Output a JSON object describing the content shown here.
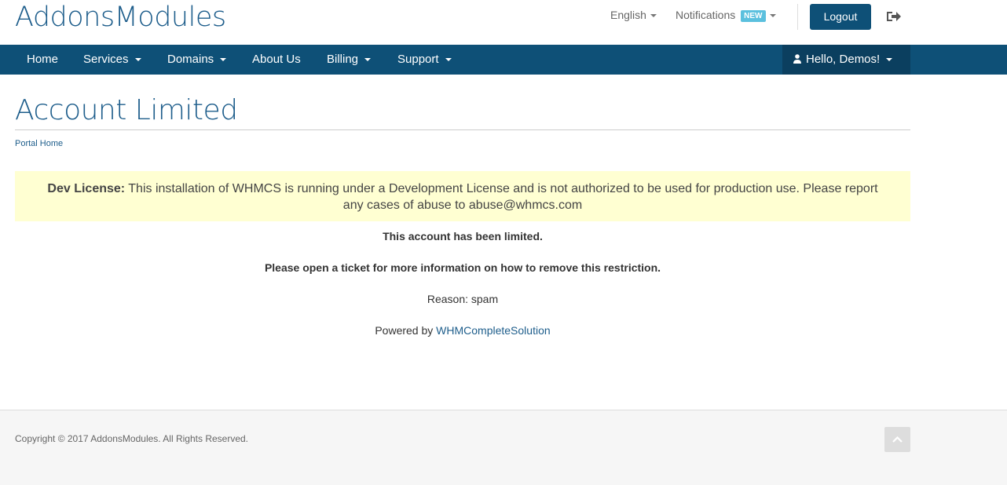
{
  "header": {
    "logo": "AddonsModules",
    "language": "English",
    "notifications_label": "Notifications",
    "notifications_badge": "NEW",
    "logout_label": "Logout"
  },
  "nav": {
    "items": [
      {
        "label": "Home"
      },
      {
        "label": "Services"
      },
      {
        "label": "Domains"
      },
      {
        "label": "About Us"
      },
      {
        "label": "Billing"
      },
      {
        "label": "Support"
      }
    ],
    "user_greeting": "Hello, Demos!"
  },
  "page": {
    "title": "Account Limited",
    "breadcrumb": "Portal Home"
  },
  "notice": {
    "label": "Dev License:",
    "text": " This installation of WHMCS is running under a Development License and is not authorized to be used for production use. Please report any cases of abuse to abuse@whmcs.com"
  },
  "content": {
    "limited_msg": "This account has been limited.",
    "ticket_msg": "Please open a ticket for more information on how to remove this restriction.",
    "reason": "Reason: spam",
    "powered_prefix": "Powered by ",
    "powered_link": "WHMCompleteSolution"
  },
  "footer": {
    "copyright": "Copyright © 2017 AddonsModules. All Rights Reserved."
  },
  "colors": {
    "brand": "#0e5077",
    "brand_text": "#1d5d8b",
    "notice_bg": "#ffffd2",
    "badge": "#5bc0de"
  }
}
